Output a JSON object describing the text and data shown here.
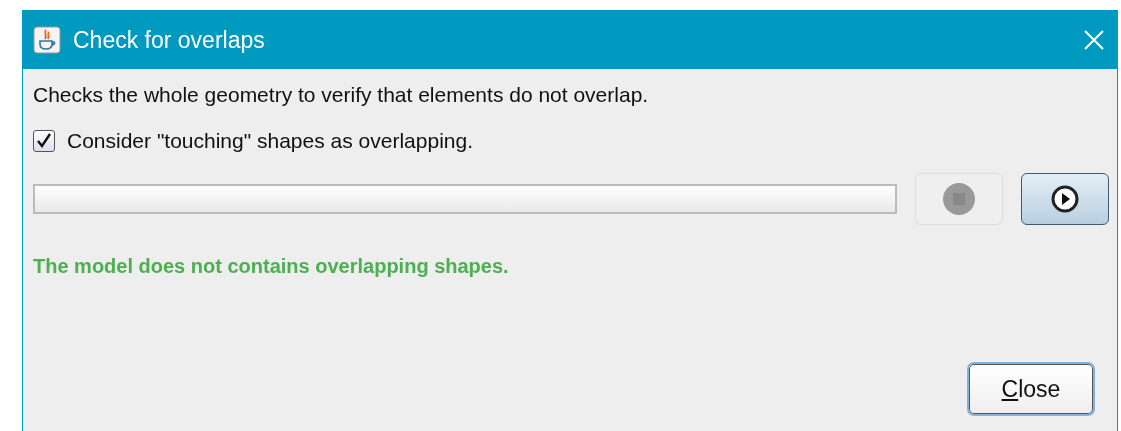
{
  "window": {
    "title": "Check for overlaps"
  },
  "description": "Checks the whole geometry to verify that elements do not overlap.",
  "option": {
    "label": "Consider \"touching\" shapes as overlapping.",
    "checked": true
  },
  "progress": {
    "level": 0
  },
  "stop_button": {
    "disabled": true
  },
  "run_button": {
    "disabled": false
  },
  "status": {
    "text": "The model does not contains overlapping shapes.",
    "color": "#4caf50"
  },
  "close_button": {
    "label": "Close"
  }
}
